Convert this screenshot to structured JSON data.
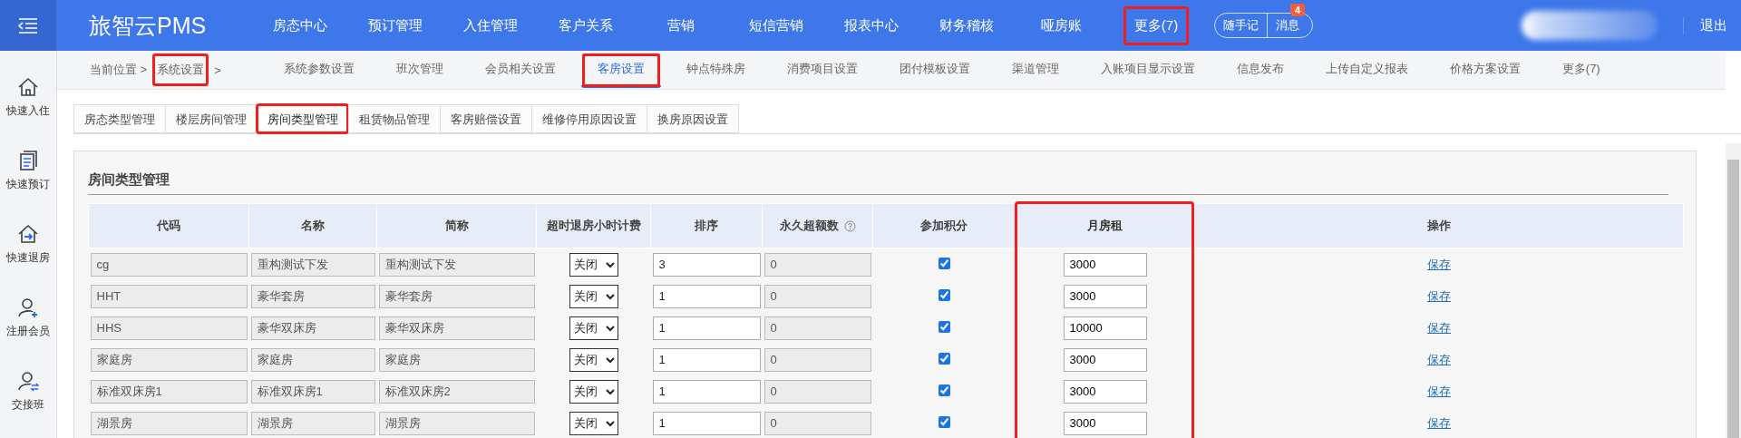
{
  "topbar": {
    "logo": "旅智云PMS",
    "nav": [
      {
        "label": "房态中心",
        "highlighted": false
      },
      {
        "label": "预订管理",
        "highlighted": false
      },
      {
        "label": "入住管理",
        "highlighted": false
      },
      {
        "label": "客户关系",
        "highlighted": false
      },
      {
        "label": "营销",
        "highlighted": false
      },
      {
        "label": "短信营销",
        "highlighted": false
      },
      {
        "label": "报表中心",
        "highlighted": false
      },
      {
        "label": "财务稽核",
        "highlighted": false
      },
      {
        "label": "哑房账",
        "highlighted": false
      },
      {
        "label": "更多(7)",
        "highlighted": true
      }
    ],
    "memo_button": "随手记",
    "message_button": "消息",
    "message_badge": "4",
    "logout": "退出"
  },
  "sidebar": {
    "items": [
      {
        "label": "快速入住",
        "kind": "checkin"
      },
      {
        "label": "快速预订",
        "kind": "booking"
      },
      {
        "label": "快速退房",
        "kind": "checkout"
      },
      {
        "label": "注册会员",
        "kind": "register"
      },
      {
        "label": "交接班",
        "kind": "shift"
      }
    ]
  },
  "breadcrumb": {
    "prefix": "当前位置 >",
    "current": "系统设置",
    "current_highlighted": true,
    "separator": ">"
  },
  "subnav": [
    {
      "label": "系统参数设置",
      "selected": false,
      "highlighted": false
    },
    {
      "label": "班次管理",
      "selected": false,
      "highlighted": false
    },
    {
      "label": "会员相关设置",
      "selected": false,
      "highlighted": false
    },
    {
      "label": "客房设置",
      "selected": true,
      "highlighted": true
    },
    {
      "label": "钟点特殊房",
      "selected": false,
      "highlighted": false
    },
    {
      "label": "消费项目设置",
      "selected": false,
      "highlighted": false
    },
    {
      "label": "团付模板设置",
      "selected": false,
      "highlighted": false
    },
    {
      "label": "渠道管理",
      "selected": false,
      "highlighted": false
    },
    {
      "label": "入账项目显示设置",
      "selected": false,
      "highlighted": false
    },
    {
      "label": "信息发布",
      "selected": false,
      "highlighted": false
    },
    {
      "label": "上传自定义报表",
      "selected": false,
      "highlighted": false
    },
    {
      "label": "价格方案设置",
      "selected": false,
      "highlighted": false
    },
    {
      "label": "更多(7)",
      "selected": false,
      "highlighted": false
    }
  ],
  "tabs": [
    {
      "label": "房态类型管理",
      "selected": false,
      "highlighted": false
    },
    {
      "label": "楼层房间管理",
      "selected": false,
      "highlighted": false
    },
    {
      "label": "房间类型管理",
      "selected": true,
      "highlighted": true
    },
    {
      "label": "租赁物品管理",
      "selected": false,
      "highlighted": false
    },
    {
      "label": "客房赔偿设置",
      "selected": false,
      "highlighted": false
    },
    {
      "label": "维修停用原因设置",
      "selected": false,
      "highlighted": false
    },
    {
      "label": "换房原因设置",
      "selected": false,
      "highlighted": false
    }
  ],
  "panel": {
    "title": "房间类型管理",
    "columns": [
      {
        "label": "代码",
        "help": false,
        "highlighted": false
      },
      {
        "label": "名称",
        "help": false,
        "highlighted": false
      },
      {
        "label": "简称",
        "help": false,
        "highlighted": false
      },
      {
        "label": "超时退房小时计费",
        "help": false,
        "highlighted": false
      },
      {
        "label": "排序",
        "help": false,
        "highlighted": false
      },
      {
        "label": "永久超额数",
        "help": true,
        "highlighted": false
      },
      {
        "label": "参加积分",
        "help": false,
        "highlighted": false
      },
      {
        "label": "月房租",
        "help": false,
        "highlighted": true
      },
      {
        "label": "操作",
        "help": false,
        "highlighted": false
      }
    ],
    "rows": [
      {
        "code": "cg",
        "name": "重构测试下发",
        "short_name": "重构测试下发",
        "overtime_billing": "关闭",
        "sort": "3",
        "permanent_excess": "0",
        "points": true,
        "monthly_rent": "3000",
        "action": "保存"
      },
      {
        "code": "HHT",
        "name": "豪华套房",
        "short_name": "豪华套房",
        "overtime_billing": "关闭",
        "sort": "1",
        "permanent_excess": "0",
        "points": true,
        "monthly_rent": "3000",
        "action": "保存"
      },
      {
        "code": "HHS",
        "name": "豪华双床房",
        "short_name": "豪华双床房",
        "overtime_billing": "关闭",
        "sort": "1",
        "permanent_excess": "0",
        "points": true,
        "monthly_rent": "10000",
        "action": "保存"
      },
      {
        "code": "家庭房",
        "name": "家庭房",
        "short_name": "家庭房",
        "overtime_billing": "关闭",
        "sort": "1",
        "permanent_excess": "0",
        "points": true,
        "monthly_rent": "3000",
        "action": "保存"
      },
      {
        "code": "标准双床房1",
        "name": "标准双床房1",
        "short_name": "标准双床房2",
        "overtime_billing": "关闭",
        "sort": "1",
        "permanent_excess": "0",
        "points": true,
        "monthly_rent": "3000",
        "action": "保存"
      },
      {
        "code": "湖景房",
        "name": "湖景房",
        "short_name": "湖景房",
        "overtime_billing": "关闭",
        "sort": "1",
        "permanent_excess": "0",
        "points": true,
        "monthly_rent": "3000",
        "action": "保存"
      }
    ]
  }
}
